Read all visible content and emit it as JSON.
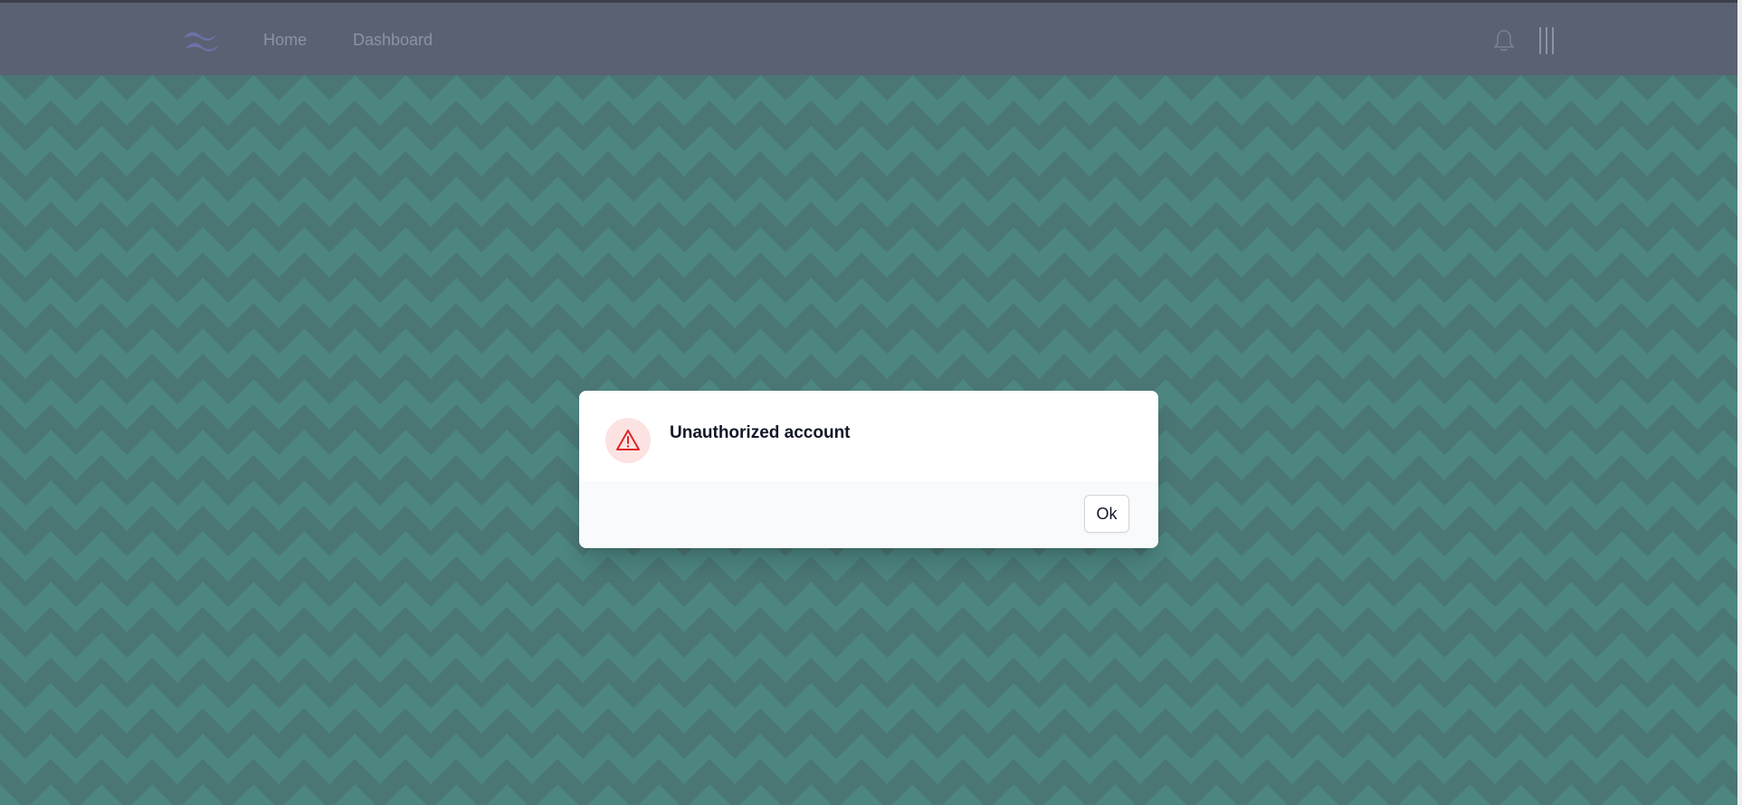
{
  "navbar": {
    "logo_icon": "tailwind-wave-icon",
    "links": [
      {
        "label": "Home"
      },
      {
        "label": "Dashboard"
      }
    ],
    "bell_icon": "bell-icon",
    "menu_icon": "menu-bars-icon",
    "background_color": "#5a6172",
    "link_color": "#8c93a3"
  },
  "background": {
    "pattern": "zigzag",
    "color": "#4d7f7a"
  },
  "modal": {
    "title": "Unauthorized account",
    "icon": "warning-triangle-icon",
    "icon_color": "#dc2626",
    "icon_background": "#fde2e2",
    "ok_label": "Ok"
  }
}
